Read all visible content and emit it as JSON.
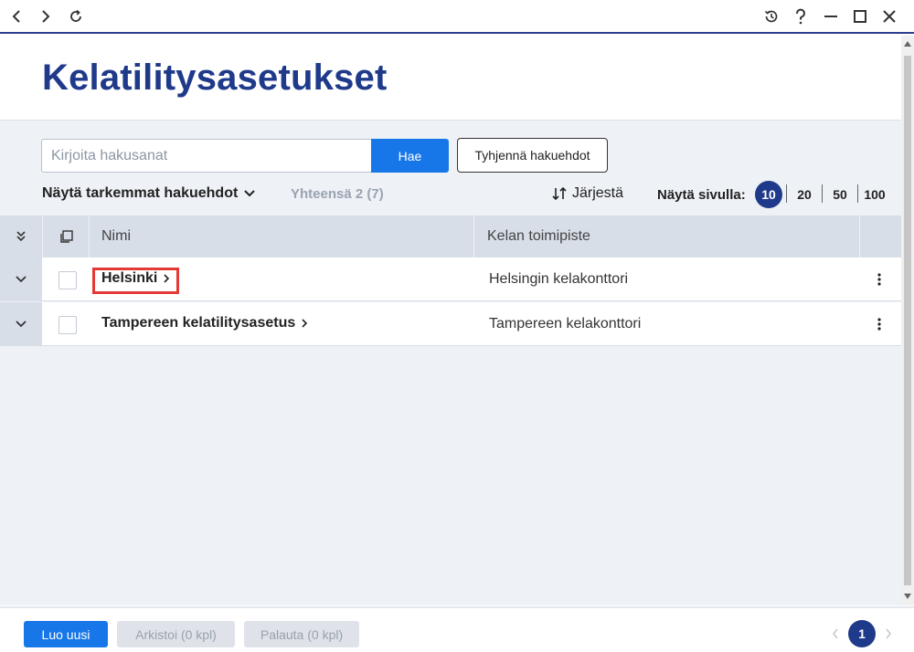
{
  "window": {
    "nav_icons": [
      "back-icon",
      "forward-icon",
      "refresh-icon"
    ],
    "actions": [
      "history-icon",
      "help-icon",
      "minimize-icon",
      "maximize-icon",
      "close-icon"
    ]
  },
  "header": {
    "title": "Kelatilitysasetukset"
  },
  "search": {
    "placeholder": "Kirjoita hakusanat",
    "value": "",
    "submit_label": "Hae",
    "clear_label": "Tyhjennä hakuehdot"
  },
  "toolbar": {
    "advanced_label": "Näytä tarkemmat hakuehdot",
    "total_label": "Yhteensä 2 (7)",
    "sort_label": "Järjestä",
    "per_page_label": "Näytä sivulla:",
    "per_page_options": [
      "10",
      "20",
      "50",
      "100"
    ],
    "per_page_selected": "10"
  },
  "table": {
    "columns": [
      "Nimi",
      "Kelan toimipiste"
    ],
    "rows": [
      {
        "name": "Helsinki",
        "office": "Helsingin kelakonttori"
      },
      {
        "name": "Tampereen kelatilitysasetus",
        "office": "Tampereen kelakonttori"
      }
    ]
  },
  "footer": {
    "create_label": "Luo uusi",
    "archive_label": "Arkistoi (0 kpl)",
    "restore_label": "Palauta (0 kpl)",
    "current_page": "1"
  },
  "colors": {
    "accent": "#1877e8",
    "brand": "#1f3a8a",
    "highlight": "#e53935"
  }
}
